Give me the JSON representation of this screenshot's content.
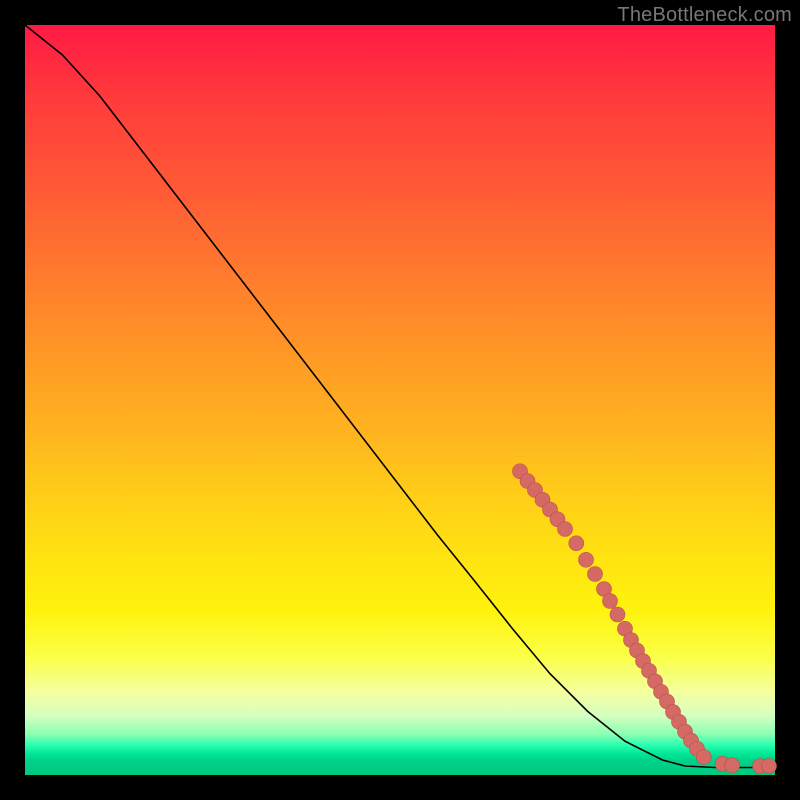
{
  "watermark": "TheBottleneck.com",
  "colors": {
    "dot_fill": "#d46a63",
    "dot_stroke": "#b94f4a",
    "line": "#000000",
    "frame": "#000000"
  },
  "chart_data": {
    "type": "line",
    "title": "",
    "xlabel": "",
    "ylabel": "",
    "xlim": [
      0,
      100
    ],
    "ylim": [
      0,
      100
    ],
    "grid": false,
    "curve": [
      {
        "x": 0,
        "y": 100
      },
      {
        "x": 5,
        "y": 96
      },
      {
        "x": 10,
        "y": 90.5
      },
      {
        "x": 15,
        "y": 84
      },
      {
        "x": 20,
        "y": 77.5
      },
      {
        "x": 25,
        "y": 71
      },
      {
        "x": 30,
        "y": 64.5
      },
      {
        "x": 35,
        "y": 58
      },
      {
        "x": 40,
        "y": 51.5
      },
      {
        "x": 45,
        "y": 45
      },
      {
        "x": 50,
        "y": 38.5
      },
      {
        "x": 55,
        "y": 32
      },
      {
        "x": 60,
        "y": 25.8
      },
      {
        "x": 65,
        "y": 19.5
      },
      {
        "x": 70,
        "y": 13.5
      },
      {
        "x": 75,
        "y": 8.5
      },
      {
        "x": 80,
        "y": 4.5
      },
      {
        "x": 85,
        "y": 2.0
      },
      {
        "x": 88,
        "y": 1.2
      },
      {
        "x": 92,
        "y": 1.0
      },
      {
        "x": 96,
        "y": 1.0
      },
      {
        "x": 100,
        "y": 1.0
      }
    ],
    "markers": [
      {
        "x": 66.0,
        "y": 40.5
      },
      {
        "x": 67.0,
        "y": 39.2
      },
      {
        "x": 68.0,
        "y": 38.0
      },
      {
        "x": 69.0,
        "y": 36.7
      },
      {
        "x": 70.0,
        "y": 35.4
      },
      {
        "x": 71.0,
        "y": 34.1
      },
      {
        "x": 72.0,
        "y": 32.8
      },
      {
        "x": 73.5,
        "y": 30.9
      },
      {
        "x": 74.8,
        "y": 28.7
      },
      {
        "x": 76.0,
        "y": 26.8
      },
      {
        "x": 77.2,
        "y": 24.8
      },
      {
        "x": 78.0,
        "y": 23.2
      },
      {
        "x": 79.0,
        "y": 21.4
      },
      {
        "x": 80.0,
        "y": 19.5
      },
      {
        "x": 80.8,
        "y": 18.0
      },
      {
        "x": 81.6,
        "y": 16.6
      },
      {
        "x": 82.4,
        "y": 15.2
      },
      {
        "x": 83.2,
        "y": 13.9
      },
      {
        "x": 84.0,
        "y": 12.5
      },
      {
        "x": 84.8,
        "y": 11.1
      },
      {
        "x": 85.6,
        "y": 9.8
      },
      {
        "x": 86.4,
        "y": 8.4
      },
      {
        "x": 87.2,
        "y": 7.1
      },
      {
        "x": 88.0,
        "y": 5.8
      },
      {
        "x": 88.8,
        "y": 4.6
      },
      {
        "x": 89.6,
        "y": 3.5
      },
      {
        "x": 90.5,
        "y": 2.4
      },
      {
        "x": 93.0,
        "y": 1.5
      },
      {
        "x": 94.3,
        "y": 1.3
      },
      {
        "x": 98.0,
        "y": 1.2
      },
      {
        "x": 99.2,
        "y": 1.2
      }
    ]
  }
}
